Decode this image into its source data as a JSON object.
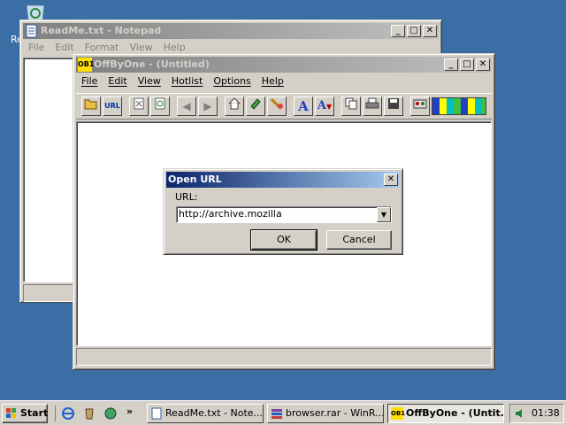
{
  "desktop": {
    "icon_label_partial": "Re"
  },
  "notepad": {
    "title": "ReadMe.txt - Notepad",
    "menu": [
      "File",
      "Edit",
      "Format",
      "View",
      "Help"
    ]
  },
  "offbyone": {
    "icon_text": "OB1",
    "title": "OffByOne - (Untitled)",
    "menu": [
      "File",
      "Edit",
      "View",
      "Hotlist",
      "Options",
      "Help"
    ],
    "toolbar_icons": [
      "open-file-icon",
      "url-icon",
      "stop-icon",
      "reload-icon",
      "back-icon",
      "forward-icon",
      "home-icon",
      "bookmark-icon",
      "hotlist-icon",
      "font-size-up-icon",
      "font-size-down-icon",
      "copy-icon",
      "print-icon",
      "save-icon",
      "settings-icon",
      "color-palette-icon"
    ],
    "toolbar_labels": {
      "url": "URL",
      "font_up": "A",
      "font_down": "A"
    }
  },
  "dialog": {
    "title": "Open URL",
    "url_label": "URL:",
    "url_value": "http://archive.mozilla",
    "ok_label": "OK",
    "cancel_label": "Cancel"
  },
  "taskbar": {
    "start_label": "Start",
    "chevron": "»",
    "tasks": [
      {
        "label": "ReadMe.txt - Note..."
      },
      {
        "label": "browser.rar - WinR..."
      },
      {
        "label": "OffByOne - (Untit..."
      }
    ],
    "tray_time": "01:38"
  },
  "colors": {
    "desktop": "#3a6ea5",
    "active_title_start": "#0a246a",
    "active_title_end": "#a6caf0",
    "face": "#d4d0c8"
  }
}
